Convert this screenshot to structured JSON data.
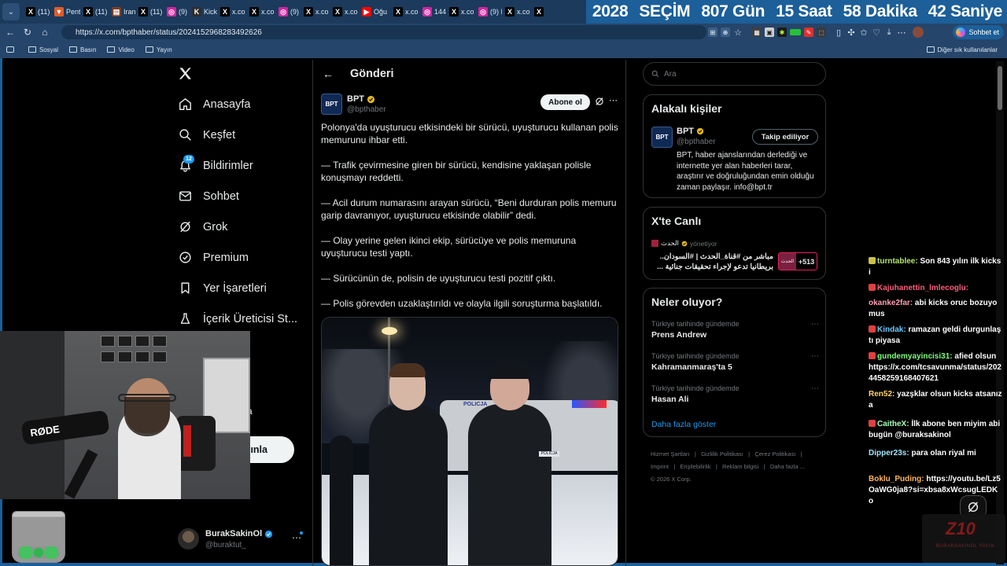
{
  "browser": {
    "tabs": [
      {
        "icon": "x",
        "label": "(11)"
      },
      {
        "icon": "pent",
        "label": "Pent"
      },
      {
        "icon": "x",
        "label": "(11)"
      },
      {
        "icon": "news",
        "label": "Iran"
      },
      {
        "icon": "x",
        "label": "(11)"
      },
      {
        "icon": "ig",
        "label": "(9) I"
      },
      {
        "icon": "kick",
        "label": "Kick"
      },
      {
        "icon": "x",
        "label": "x.co"
      },
      {
        "icon": "x",
        "label": "x.co"
      },
      {
        "icon": "ig",
        "label": "(9) I"
      },
      {
        "icon": "x",
        "label": "x.co"
      },
      {
        "icon": "x",
        "label": "x.co"
      },
      {
        "icon": "yt",
        "label": "Oğu"
      },
      {
        "icon": "x",
        "label": "x.co"
      },
      {
        "icon": "ig",
        "label": "144("
      },
      {
        "icon": "x",
        "label": "x.co"
      },
      {
        "icon": "ig",
        "label": "(9) I"
      },
      {
        "icon": "x",
        "label": "x.co"
      },
      {
        "icon": "x",
        "label": ""
      }
    ],
    "url": "https://x.com/bpthaber/status/2024152968283492626",
    "sohbet_label": "Sohbet et",
    "bookmarks": [
      "Sosyal",
      "Basın",
      "Video",
      "Yayın"
    ],
    "bookmarks_right": "Diğer sık kullanılanlar"
  },
  "countdown": {
    "year": "2028",
    "label": "SEÇİM",
    "days": "807 Gün",
    "hours": "15 Saat",
    "minutes": "58 Dakika",
    "seconds": "42 Saniye"
  },
  "leftnav": {
    "items": [
      "Anasayfa",
      "Keşfet",
      "Bildirimler",
      "Sohbet",
      "Grok",
      "Premium",
      "Yer İşaretleri",
      "İçerik Üreticisi St..."
    ],
    "notif_badge": "12",
    "post_button_fragment": "ınla",
    "hidden_fragment": "a",
    "account_name": "BurakSakinOl",
    "account_handle": "@buraktut_"
  },
  "post": {
    "header_title": "Gönderi",
    "author_name": "BPT",
    "author_handle": "@bpthaber",
    "avatar_text": "BPT",
    "follow_label": "Abone ol",
    "paragraphs": [
      "Polonya'da uyuşturucu etkisindeki bir sürücü, uyuşturucu kullanan polis memurunu ihbar etti.",
      "— Trafik çevirmesine giren bir sürücü, kendisine yaklaşan polisle konuşmayı reddetti.",
      "— Acil durum numarasını arayan sürücü, “Beni durduran polis memuru garip davranıyor, uyuşturucu etkisinde olabilir” dedi.",
      "— Olay yerine gelen ikinci ekip, sürücüye ve polis memuruna uyuşturucu testi yaptı.",
      "— Sürücünün de, polisin de uyuşturucu testi pozitif çıktı.",
      "— Polis görevden uzaklaştırıldı ve olayla ilgili soruşturma başlatıldı."
    ],
    "image_car_text": "POLICJA",
    "badge_left": "POLICJA",
    "badge_right": "POLICJA"
  },
  "sidebar": {
    "search_placeholder": "Ara",
    "related": {
      "title": "Alakalı kişiler",
      "name": "BPT",
      "handle": "@bpthaber",
      "button": "Takip ediliyor",
      "bio": "BPT, haber ajanslarından derlediği ve internette yer alan haberleri tarar, araştırır ve doğruluğundan emin olduğu zaman paylaşır. info@bpt.tr"
    },
    "live": {
      "title": "X'te Canlı",
      "host": "الحدث",
      "host_suffix": "yönetiyor",
      "text_line1": "مباشر من #قناة_الحدث | #السودان..",
      "text_line2": "بريطانيا تدعو لإجراء تحقيقات جنائية ...",
      "count": "+513",
      "thumb_text": "الحدث"
    },
    "trends": {
      "title": "Neler oluyor?",
      "items": [
        {
          "category": "Türkiye tarihinde gündemde",
          "name": "Prens Andrew"
        },
        {
          "category": "Türkiye tarihinde gündemde",
          "name": "Kahramanmaraş'ta 5"
        },
        {
          "category": "Türkiye tarihinde gündemde",
          "name": "Hasan Ali"
        }
      ],
      "show_more": "Daha fazla göster"
    },
    "footer_links": [
      "Hizmet Şartları",
      "|",
      "Gizlilik Politikası",
      "|",
      "Çerez Politikası",
      "|",
      "Imprint",
      "|",
      "Erişilebilirlik",
      "|",
      "Reklam bilgisi",
      "|",
      "Daha fazla ...",
      "© 2026 X Corp."
    ]
  },
  "chat": [
    {
      "user": "turntablee",
      "color": "#b7e36d",
      "msg": " Son 843 yılın ilk kicksi",
      "badge": "#c9c247"
    },
    {
      "user": "Kajuhanettin_lmlecoglu",
      "color": "#ff5c7a",
      "msg": " ",
      "badge": "#e14040"
    },
    {
      "user": "okanke2far",
      "color": "#ff9fb1",
      "msg": " abi kicks oruc bozuyomus",
      "badge": ""
    },
    {
      "user": "Kindak",
      "color": "#69c7ff",
      "msg": " ramazan geldi durgunlaştı piyasa",
      "badge": "#e14040"
    },
    {
      "user": "gundemyayincisi31",
      "color": "#7dff7a",
      "msg": " afied olsun https://x.com/tcsavunma/status/2024458259168407621",
      "badge": "#e14040"
    },
    {
      "user": "Ren52",
      "color": "#ffd36b",
      "msg": " yazşklar olsun kicks atsanıza",
      "badge": ""
    },
    {
      "user": "CaitheX",
      "color": "#a6ffb8",
      "msg": " İlk abone ben miyim abi bugün @buraksakinol",
      "badge": "#e14040"
    },
    {
      "user": "Dipper23s",
      "color": "#9fe7ff",
      "msg": " para olan riyal mi",
      "badge": ""
    },
    {
      "user": "Boklu_Puding",
      "color": "#ffb45c",
      "msg": " https://youtu.be/Lz5OaWG0ja8?si=xbsa8xWcsugLEDKo",
      "badge": ""
    }
  ],
  "webcam": {
    "mic_brand": "RØDE"
  },
  "watermark": {
    "logo": "Z10",
    "text": "BURAKSAKINOL YAYIN"
  }
}
